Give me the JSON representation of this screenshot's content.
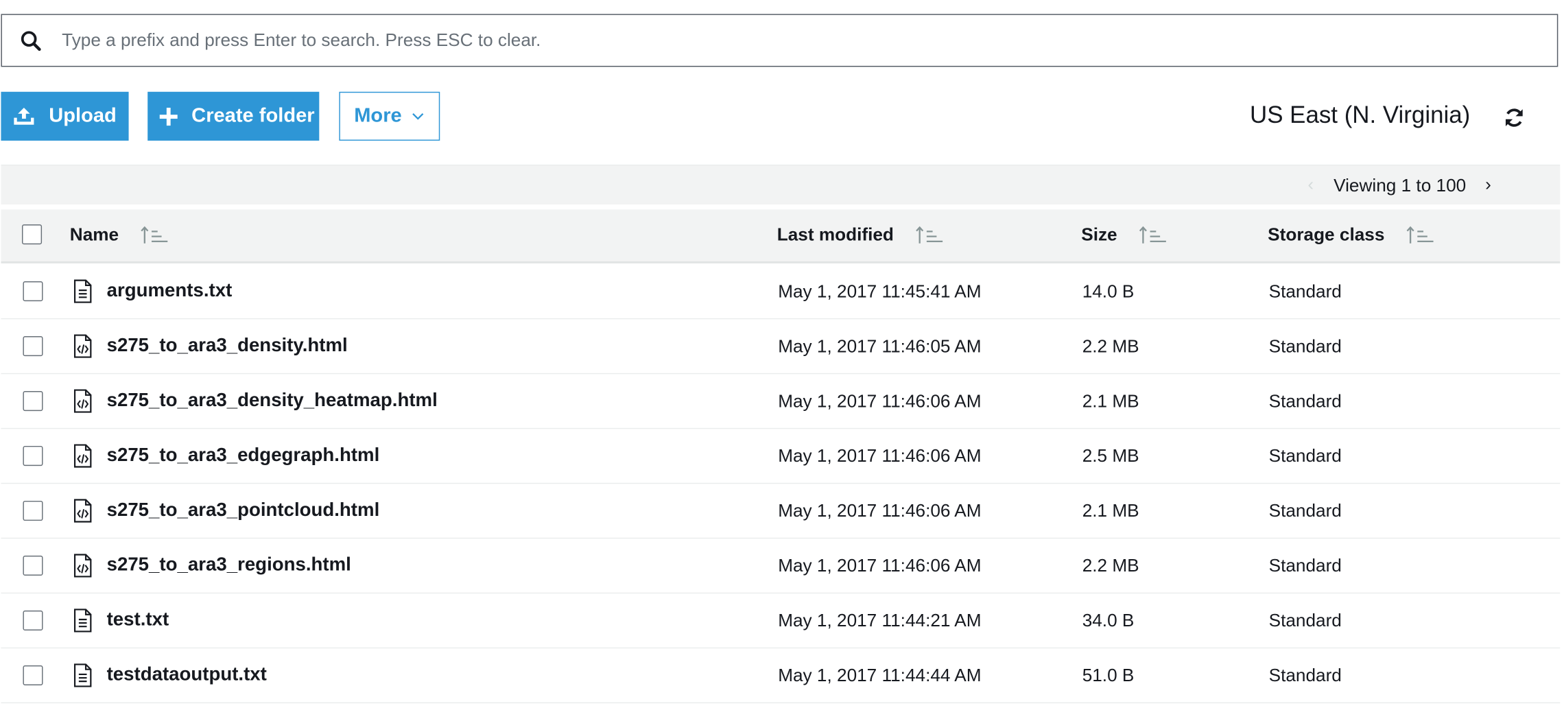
{
  "search": {
    "placeholder": "Type a prefix and press Enter to search. Press ESC to clear."
  },
  "toolbar": {
    "upload_label": "Upload",
    "create_folder_label": "Create folder",
    "more_label": "More",
    "region": "US East (N. Virginia)"
  },
  "pagination": {
    "viewing": "Viewing 1 to 100"
  },
  "columns": {
    "name": "Name",
    "last_modified": "Last modified",
    "size": "Size",
    "storage_class": "Storage class"
  },
  "rows": [
    {
      "name": "arguments.txt",
      "icon": "text-file-icon",
      "last_modified": "May 1, 2017 11:45:41 AM",
      "size": "14.0 B",
      "storage_class": "Standard"
    },
    {
      "name": "s275_to_ara3_density.html",
      "icon": "code-file-icon",
      "last_modified": "May 1, 2017 11:46:05 AM",
      "size": "2.2 MB",
      "storage_class": "Standard"
    },
    {
      "name": "s275_to_ara3_density_heatmap.html",
      "icon": "code-file-icon",
      "last_modified": "May 1, 2017 11:46:06 AM",
      "size": "2.1 MB",
      "storage_class": "Standard"
    },
    {
      "name": "s275_to_ara3_edgegraph.html",
      "icon": "code-file-icon",
      "last_modified": "May 1, 2017 11:46:06 AM",
      "size": "2.5 MB",
      "storage_class": "Standard"
    },
    {
      "name": "s275_to_ara3_pointcloud.html",
      "icon": "code-file-icon",
      "last_modified": "May 1, 2017 11:46:06 AM",
      "size": "2.1 MB",
      "storage_class": "Standard"
    },
    {
      "name": "s275_to_ara3_regions.html",
      "icon": "code-file-icon",
      "last_modified": "May 1, 2017 11:46:06 AM",
      "size": "2.2 MB",
      "storage_class": "Standard"
    },
    {
      "name": "test.txt",
      "icon": "text-file-icon",
      "last_modified": "May 1, 2017 11:44:21 AM",
      "size": "34.0 B",
      "storage_class": "Standard"
    },
    {
      "name": "testdataoutput.txt",
      "icon": "text-file-icon",
      "last_modified": "May 1, 2017 11:44:44 AM",
      "size": "51.0 B",
      "storage_class": "Standard"
    }
  ],
  "colors": {
    "accent": "#2e96d6",
    "text": "#16191f",
    "header_bg": "#f2f3f3",
    "border": "#eaeded"
  }
}
